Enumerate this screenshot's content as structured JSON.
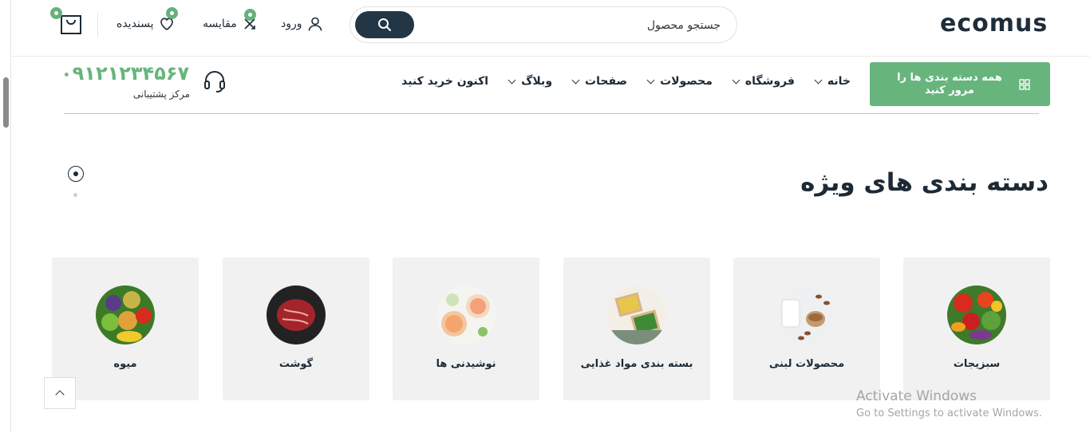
{
  "header": {
    "logo": "ecomus",
    "search_placeholder": "جستجو محصول",
    "login_label": "ورود",
    "compare_label": "مقایسه",
    "wishlist_label": "پسندیده"
  },
  "nav": {
    "categories_button": "همه دسته بندی ها را مرور کنید",
    "items": [
      {
        "label": "خانه"
      },
      {
        "label": "فروشگاه"
      },
      {
        "label": "محصولات"
      },
      {
        "label": "صفحات"
      },
      {
        "label": "وبلاگ"
      },
      {
        "label": "اکنون خرید کنید"
      }
    ],
    "support_phone": "۰۹۱۲۱۲۳۴۵۶۷",
    "support_label": "مرکز پشتیبانی"
  },
  "section": {
    "title": "دسته بندی های ویژه",
    "categories": [
      {
        "label": "سبزیجات"
      },
      {
        "label": "محصولات لبنی"
      },
      {
        "label": "بسته بندی مواد غذایی"
      },
      {
        "label": "نوشیدنی ها"
      },
      {
        "label": "گوشت"
      },
      {
        "label": "میوه"
      }
    ]
  },
  "windows_notice": {
    "title": "Activate Windows",
    "subtitle": "Go to Settings to activate Windows."
  },
  "colors": {
    "accent": "#67b57d",
    "dark": "#233646"
  }
}
